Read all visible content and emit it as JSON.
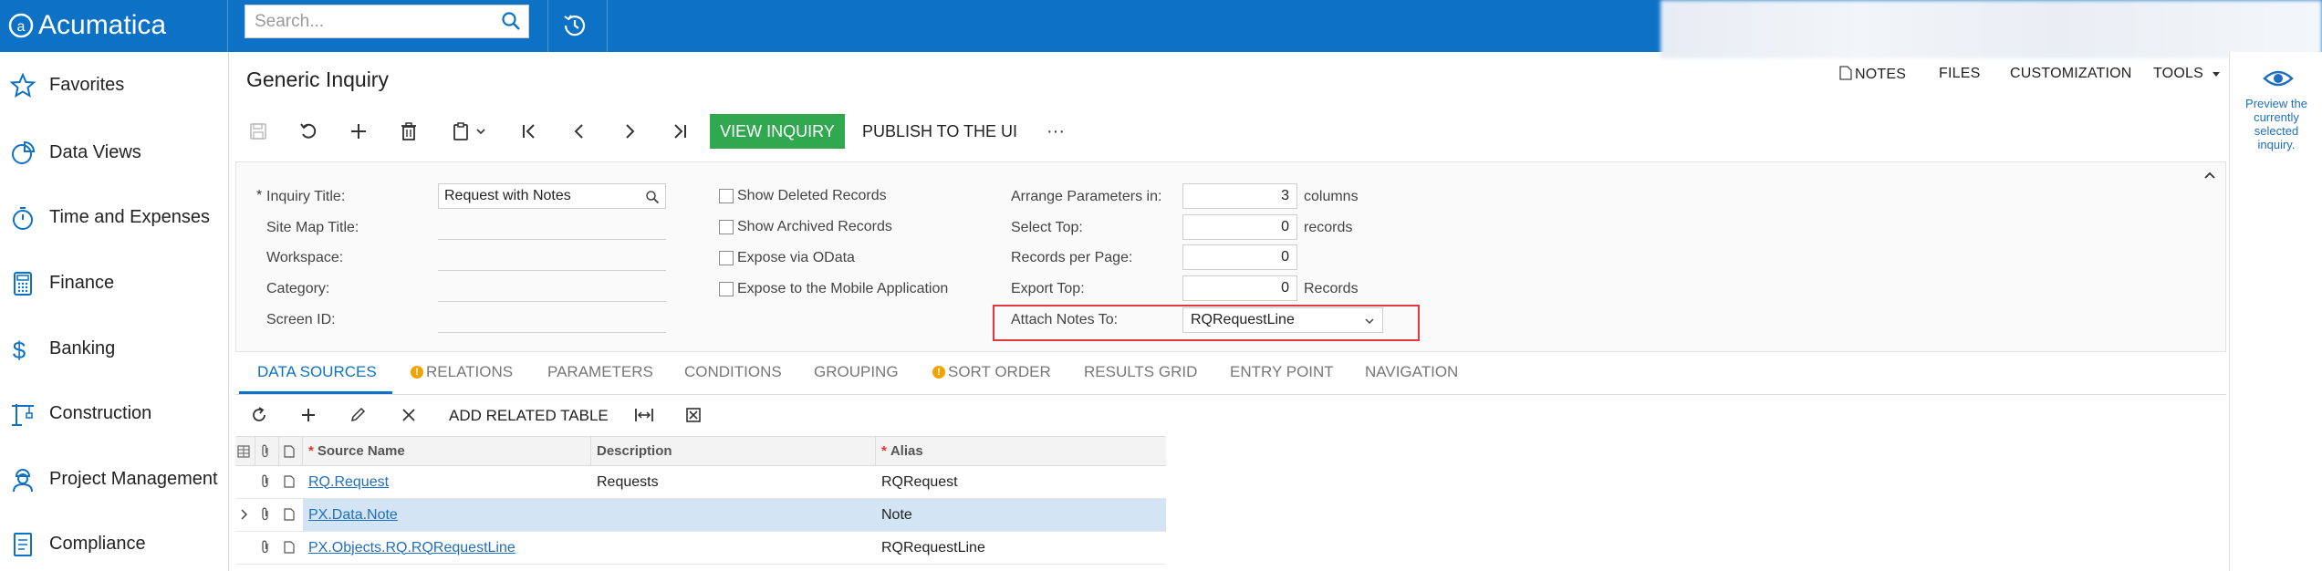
{
  "app": {
    "brand": "Acumatica"
  },
  "search": {
    "placeholder": "Search..."
  },
  "sidebar": {
    "items": [
      {
        "label": "Favorites",
        "icon": "star-icon"
      },
      {
        "label": "Data Views",
        "icon": "pie-chart-icon"
      },
      {
        "label": "Time and Expenses",
        "icon": "stopwatch-icon"
      },
      {
        "label": "Finance",
        "icon": "calculator-icon"
      },
      {
        "label": "Banking",
        "icon": "dollar-icon"
      },
      {
        "label": "Construction",
        "icon": "crane-icon"
      },
      {
        "label": "Project Management",
        "icon": "worker-icon"
      },
      {
        "label": "Compliance",
        "icon": "document-icon"
      }
    ]
  },
  "page": {
    "title": "Generic Inquiry"
  },
  "header_links": {
    "notes": "NOTES",
    "files": "FILES",
    "customization": "CUSTOMIZATION",
    "tools": "TOOLS"
  },
  "right_panel": {
    "preview_text": "Preview the currently selected inquiry."
  },
  "toolbar": {
    "view_inquiry": "VIEW INQUIRY",
    "publish": "PUBLISH TO THE UI",
    "more": "···"
  },
  "form": {
    "col1": {
      "inquiry_title_label": "Inquiry Title:",
      "inquiry_title_value": "Request with Notes",
      "site_map_title_label": "Site Map Title:",
      "workspace_label": "Workspace:",
      "category_label": "Category:",
      "screen_id_label": "Screen ID:"
    },
    "col2": {
      "show_deleted": "Show Deleted Records",
      "show_archived": "Show Archived Records",
      "expose_odata": "Expose via OData",
      "expose_mobile": "Expose to the Mobile Application"
    },
    "col3": {
      "arrange_label": "Arrange Parameters in:",
      "arrange_value": "3",
      "arrange_unit": "columns",
      "select_top_label": "Select Top:",
      "select_top_value": "0",
      "select_top_unit": "records",
      "records_per_page_label": "Records per Page:",
      "records_per_page_value": "0",
      "export_top_label": "Export Top:",
      "export_top_value": "0",
      "export_top_unit": "Records",
      "attach_notes_label": "Attach Notes To:",
      "attach_notes_value": "RQRequestLine"
    }
  },
  "tabs": [
    "DATA SOURCES",
    "RELATIONS",
    "PARAMETERS",
    "CONDITIONS",
    "GROUPING",
    "SORT ORDER",
    "RESULTS GRID",
    "ENTRY POINT",
    "NAVIGATION"
  ],
  "grid_toolbar": {
    "add_related_table": "ADD RELATED TABLE"
  },
  "grid": {
    "columns": [
      "Source Name",
      "Description",
      "Alias"
    ],
    "rows": [
      {
        "source": "RQ.Request",
        "description": "Requests",
        "alias": "RQRequest"
      },
      {
        "source": "PX.Data.Note",
        "description": "",
        "alias": "Note"
      },
      {
        "source": "PX.Objects.RQ.RQRequestLine",
        "description": "",
        "alias": "RQRequestLine"
      }
    ]
  },
  "colors": {
    "brand_blue": "#0d72c6",
    "view_button_green": "#2fa84f",
    "highlight_red": "#e0383e",
    "selected_row": "#d3e4f5"
  }
}
